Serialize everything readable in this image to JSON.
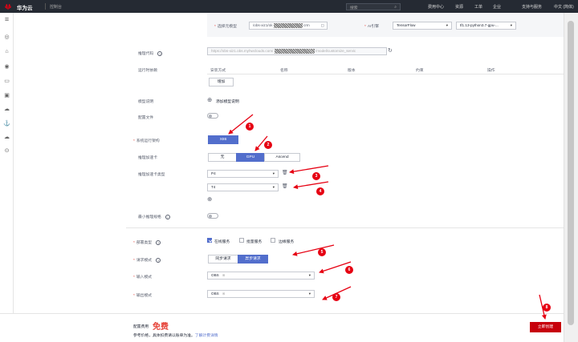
{
  "topbar": {
    "brand": "华为云",
    "console": "控制台",
    "search_placeholder": "搜索",
    "nav": [
      "费用中心",
      "资源",
      "工单",
      "企业",
      "支持与服务",
      "中文 (简体)"
    ]
  },
  "form": {
    "select_meta_model_label": "选择元模型",
    "meta_model_path": "/obs-xiz1/ok",
    "meta_model_suffix": "crm",
    "ai_engine_label": "AI引擎",
    "ai_engine": "TensorFlow",
    "engine_version": "tf1.13-python3.7-gpu-...",
    "inference_code_label": "推理代码",
    "inference_code_url": "https://obs-xiz1.obs.myhwclouds.com/",
    "inference_code_suffix": "/model/customize_servic",
    "runtime_deps_label": "运行时依赖",
    "deps_headers": [
      "安装方式",
      "名称",
      "版本",
      "约束",
      "操作"
    ],
    "add_dep_button": "增加",
    "model_description_label": "模型说明",
    "add_model_description": "添加模型说明",
    "config_file_label": "配置文件",
    "system_arch_label": "系统运行架构",
    "arch_option": "X86",
    "accelerator_label": "推理加速卡",
    "accelerator_options": [
      "无",
      "GPU",
      "Ascend"
    ],
    "accelerator_type_label": "推理加速卡类型",
    "accelerator_types": [
      "P4",
      "T4"
    ],
    "min_spec_label": "最小推理规格",
    "deploy_type_label": "部署类型",
    "deploy_types": [
      "在线服务",
      "批量服务",
      "边缘服务"
    ],
    "request_mode_label": "请求模式",
    "request_modes": [
      "同步请求",
      "异步请求"
    ],
    "input_mode_label": "输入模式",
    "input_mode_value": "OBS",
    "output_mode_label": "输出模式",
    "output_mode_value": "OBS"
  },
  "footer": {
    "fee_label": "配置费用",
    "fee_value": "免费",
    "fee_note": "参考价格，具体扣费请以账单为准。",
    "fee_link": "了解计费详情",
    "create_button": "立即创建"
  },
  "annotations": [
    "1",
    "2",
    "3",
    "4",
    "5",
    "6",
    "7",
    "8"
  ],
  "colors": {
    "accent": "#526ecc",
    "annotation": "#e60012",
    "topbar": "#252a33"
  },
  "icons": [
    "huawei-logo-icon",
    "search-icon",
    "menu-icon",
    "folder-icon",
    "plus-circle-icon",
    "trash-icon",
    "refresh-icon",
    "question-icon"
  ]
}
